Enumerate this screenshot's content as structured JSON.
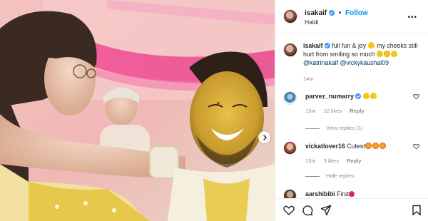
{
  "post": {
    "username": "isakaif",
    "follow_label": "Follow",
    "dot": "•",
    "location": "Haldi",
    "more_label": "•••"
  },
  "caption": {
    "username": "isakaif",
    "text_part1": "full fun & joy",
    "text_part2": "my cheeks still hurt from smiling so much",
    "mentions": "@katrinakaif @vickykaushal09",
    "timestamp": "14m"
  },
  "comments": [
    {
      "username": "parvez_numarry",
      "text": "",
      "time": "13m",
      "likes": "12 likes",
      "reply": "Reply",
      "replies_label": "View replies (1)"
    },
    {
      "username": "vickatlover16",
      "text": "Cutest",
      "time": "13m",
      "likes": "3 likes",
      "reply": "Reply",
      "replies_label": "Hide replies"
    },
    {
      "username": "aarshibibi",
      "text": "First"
    }
  ],
  "icons": {
    "like": "heart-icon",
    "comment": "comment-icon",
    "share": "share-icon",
    "save": "bookmark-icon",
    "next": "chevron-right-icon",
    "verified": "verified-badge-icon"
  },
  "colors": {
    "link_blue": "#0095f6",
    "verified_blue": "#3897f0",
    "mention": "#00376b",
    "muted": "#8e8e8e"
  }
}
